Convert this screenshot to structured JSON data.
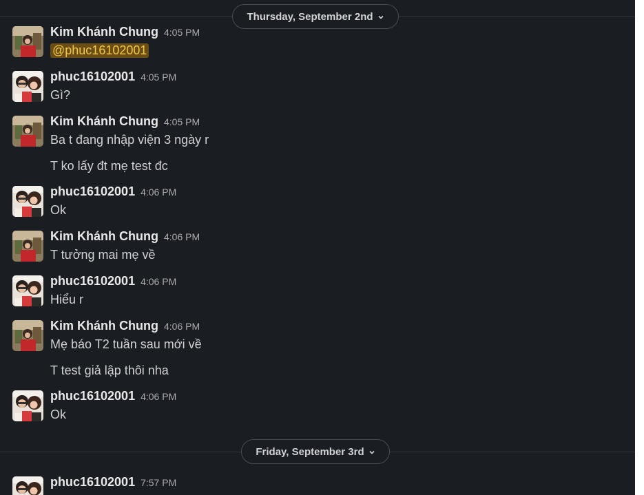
{
  "dates": [
    {
      "label": "Thursday, September 2nd"
    },
    {
      "label": "Friday, September 3rd"
    }
  ],
  "messages": [
    {
      "author": "Kim Khánh Chung",
      "time": "4:05 PM",
      "mention": "@phuc16102001"
    },
    {
      "author": "phuc16102001",
      "time": "4:05 PM",
      "lines": [
        "Gì?"
      ]
    },
    {
      "author": "Kim Khánh Chung",
      "time": "4:05 PM",
      "lines": [
        "Ba t đang nhập viện 3 ngày r",
        "T ko lấy đt mẹ test đc"
      ]
    },
    {
      "author": "phuc16102001",
      "time": "4:06 PM",
      "lines": [
        "Ok"
      ]
    },
    {
      "author": "Kim Khánh Chung",
      "time": "4:06 PM",
      "lines": [
        "T tưởng mai mẹ về"
      ]
    },
    {
      "author": "phuc16102001",
      "time": "4:06 PM",
      "lines": [
        "Hiểu r"
      ]
    },
    {
      "author": "Kim Khánh Chung",
      "time": "4:06 PM",
      "lines": [
        "Mẹ báo T2 tuần sau mới về",
        "T test giả lập thôi nha"
      ]
    },
    {
      "author": "phuc16102001",
      "time": "4:06 PM",
      "lines": [
        "Ok"
      ]
    },
    {
      "author": "phuc16102001",
      "time": "7:57 PM",
      "lines": []
    }
  ],
  "colors": {
    "background": "#1a1d21",
    "mention_bg": "#6b4e16",
    "mention_fg": "#f2c744"
  }
}
